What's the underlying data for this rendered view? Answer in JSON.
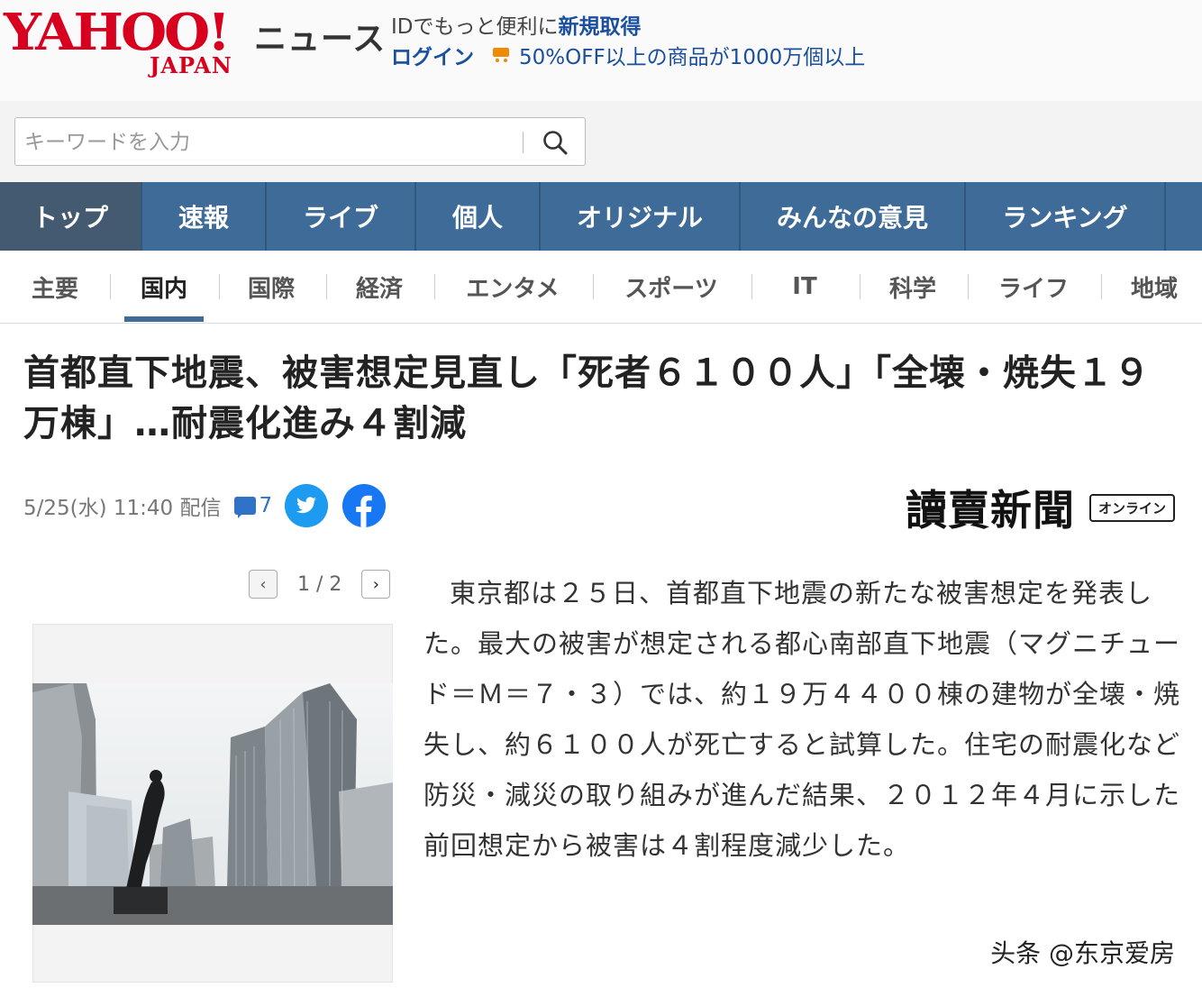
{
  "header": {
    "logo_text": "YAHOO!",
    "logo_sub": "JAPAN",
    "service_name": "ニュース",
    "promo_prefix": "IDでもっと便利に",
    "promo_link": "新規取得",
    "login_label": "ログイン",
    "sale_text": "50%OFF以上の商品が1000万個以上"
  },
  "search": {
    "placeholder": "キーワードを入力"
  },
  "main_nav": [
    {
      "label": "トップ"
    },
    {
      "label": "速報"
    },
    {
      "label": "ライブ"
    },
    {
      "label": "個人"
    },
    {
      "label": "オリジナル"
    },
    {
      "label": "みんなの意見"
    },
    {
      "label": "ランキング"
    }
  ],
  "sub_nav": [
    {
      "label": "主要"
    },
    {
      "label": "国内"
    },
    {
      "label": "国際"
    },
    {
      "label": "経済"
    },
    {
      "label": "エンタメ"
    },
    {
      "label": "スポーツ"
    },
    {
      "label": "IT"
    },
    {
      "label": "科学"
    },
    {
      "label": "ライフ"
    },
    {
      "label": "地域"
    }
  ],
  "article": {
    "headline": "首都直下地震、被害想定見直し「死者６１００人」「全壊・焼失１９万棟」…耐震化進み４割減",
    "date": "5/25(水) 11:40 配信",
    "comment_count": "7",
    "source_name": "讀賣新聞",
    "source_badge": "オンライン",
    "pager": "1 / 2",
    "pager_prev": "‹",
    "pager_next": "›",
    "body": "東京都は２５日、首都直下地震の新たな被害想定を発表した。最大の被害が想定される都心南部直下地震（マグニチュード＝Ｍ＝７・３）では、約１９万４４００棟の建物が全壊・焼失し、約６１００人が死亡すると試算した。住宅の耐震化など防災・減災の取り組みが進んだ結果、２０１２年４月に示した前回想定から被害は４割程度減少した。"
  },
  "watermark": "头条 @东京爱房",
  "colors": {
    "brand_red": "#d7001e",
    "nav_blue": "#3f6b98",
    "link_blue": "#1a4fa0",
    "twitter": "#1d9bf0",
    "facebook": "#1877f2"
  }
}
